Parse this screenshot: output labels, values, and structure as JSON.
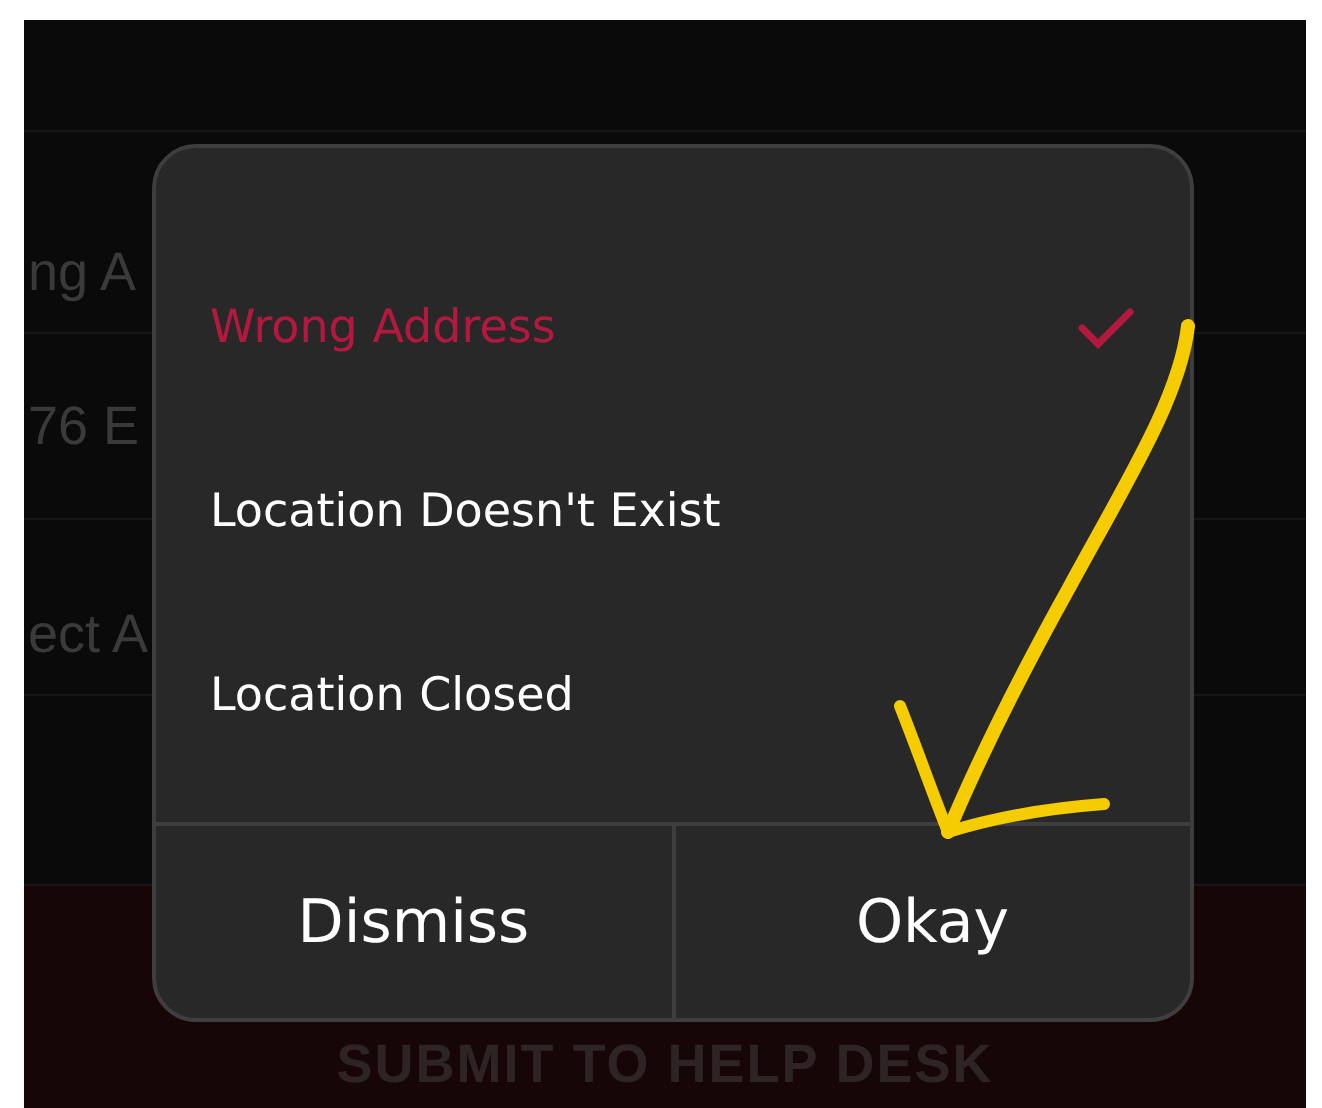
{
  "background_rows": [
    {
      "text": "ng A"
    },
    {
      "text": "76 E"
    },
    {
      "text": "ect A"
    }
  ],
  "submit_button": {
    "label": "SUBMIT TO HELP DESK"
  },
  "dialog": {
    "options": [
      {
        "label": "Wrong Address",
        "selected": true
      },
      {
        "label": "Location Doesn't Exist",
        "selected": false
      },
      {
        "label": "Location Closed",
        "selected": false
      }
    ],
    "buttons": [
      {
        "label": "Dismiss"
      },
      {
        "label": "Okay"
      }
    ]
  }
}
